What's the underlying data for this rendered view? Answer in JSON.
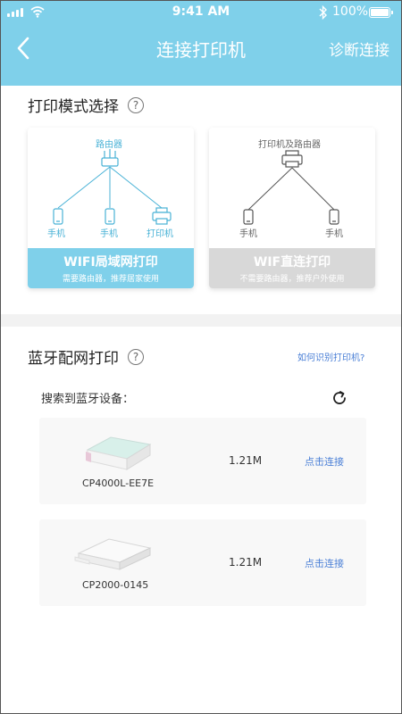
{
  "status_bar": {
    "time": "9:41 AM",
    "battery": "100%"
  },
  "header": {
    "title": "连接打印机",
    "diagnose_label": "诊断连接",
    "color": "#7fd0ea"
  },
  "print_mode": {
    "title": "打印模式选择",
    "help": "?",
    "wifi_card": {
      "name": "WIFI局域网打印",
      "subtitle": "需要路由器，推荐居家使用",
      "router_label": "路由器",
      "phone_label_1": "手机",
      "phone_label_2": "手机",
      "printer_label": "打印机",
      "accent": "#7fd0ea"
    },
    "direct_card": {
      "name": "WIF直连打印",
      "subtitle": "不需要路由器，推荐户外使用",
      "top_label": "打印机及路由器",
      "phone_label_1": "手机",
      "phone_label_2": "手机"
    }
  },
  "bluetooth": {
    "title": "蓝牙配网打印",
    "help": "?",
    "how_link": "如何识别打印机?",
    "found_label": "搜索到蓝牙设备：",
    "devices": [
      {
        "name": "CP4000L-EE7E",
        "size": "1.21M",
        "action": "点击连接"
      },
      {
        "name": "CP2000-0145",
        "size": "1.21M",
        "action": "点击连接"
      }
    ]
  }
}
